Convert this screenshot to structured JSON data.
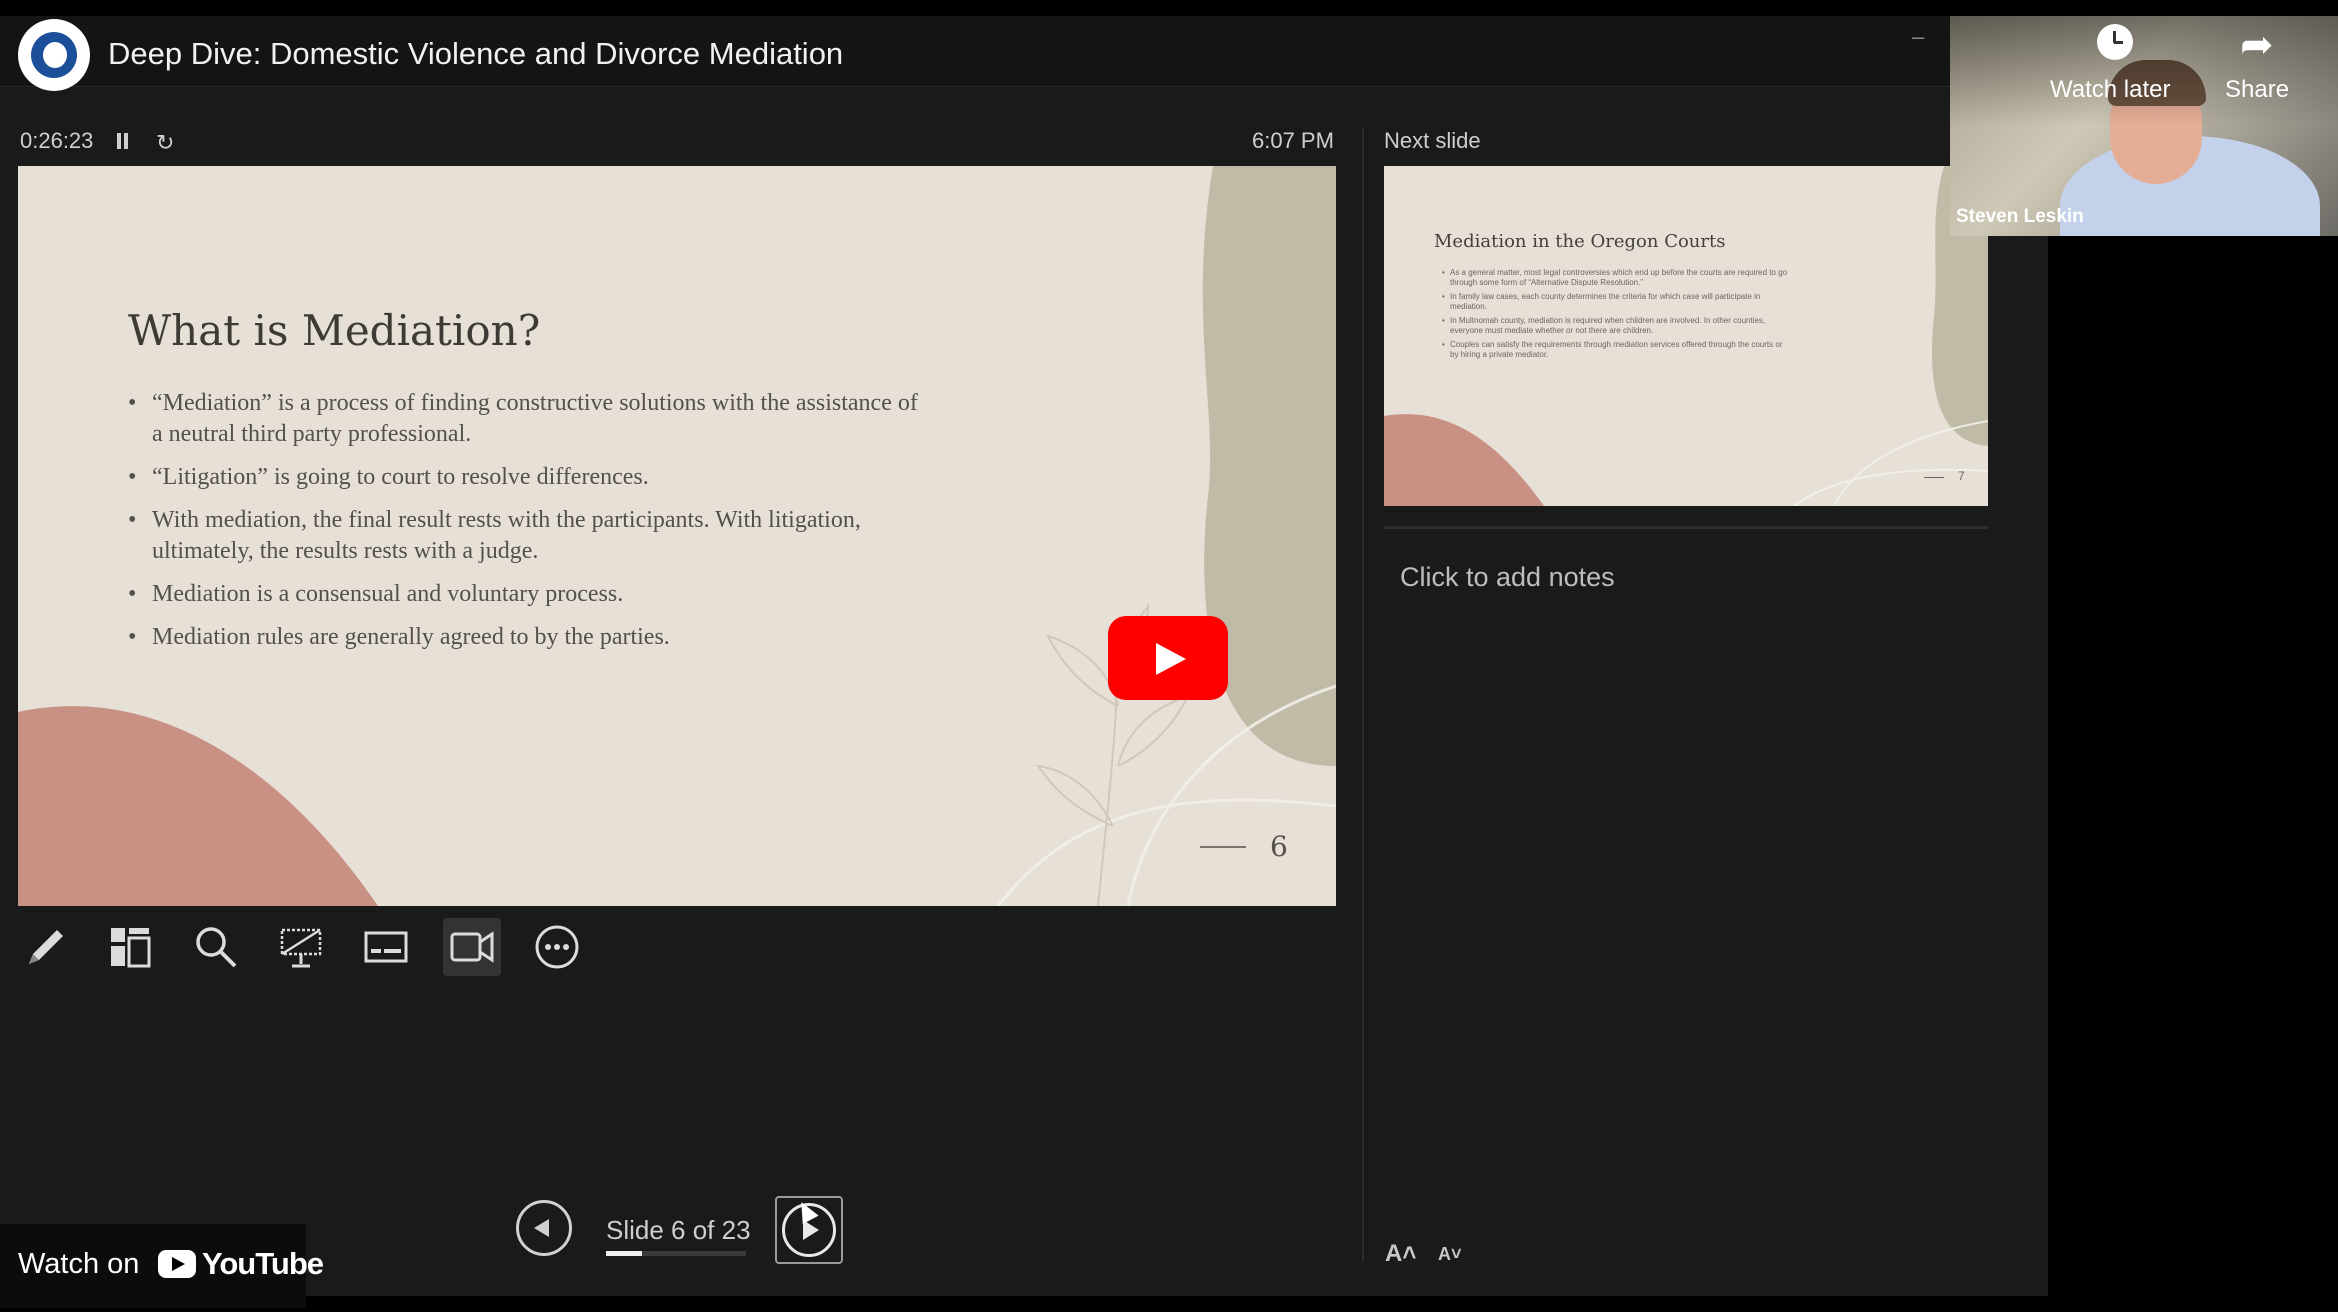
{
  "header": {
    "title": "Deep Dive: Domestic Violence and Divorce Mediation",
    "channel_logo": "circle-d-logo"
  },
  "presenter_view": {
    "elapsed_time": "0:26:23",
    "clock_time": "6:07 PM",
    "next_slide_label": "Next slide",
    "notes_placeholder": "Click to add notes",
    "current_slide": {
      "title": "What is Mediation?",
      "bullets": [
        "“Mediation” is a process of finding constructive solutions with the assistance of a neutral third party professional.",
        "“Litigation” is going to court to resolve differences.",
        "With mediation, the final result rests with the participants. With litigation, ultimately, the results rests with a judge.",
        "Mediation is a consensual and voluntary process.",
        "Mediation rules are generally agreed to by the parties."
      ],
      "number": "6"
    },
    "next_slide": {
      "title": "Mediation in the Oregon Courts",
      "bullets": [
        "As a general matter, most legal controversies which end up before the courts are required to go through some form of “Alternative Dispute Resolution.”",
        "In family law cases, each county determines the criteria for which case will participate in mediation.",
        "In Multnomah county, mediation is required when children are involved. In other counties, everyone must mediate whether or not there are children.",
        "Couples can satisfy the requirements through mediation services offered through the courts or by hiring a private mediator."
      ],
      "number": "7"
    },
    "slide_counter": "Slide 6 of 23",
    "progress_fraction": 0.26,
    "tools": [
      "pen-icon",
      "slides-grid-icon",
      "zoom-icon",
      "laser-pointer-icon",
      "subtitles-icon",
      "camera-icon",
      "more-options-icon"
    ],
    "font_increase": "A˄",
    "font_decrease": "A˅"
  },
  "overlay": {
    "watch_on": "Watch on",
    "youtube": "YouTube",
    "watch_later": "Watch later",
    "share": "Share",
    "participant_name": "Steven Leskin"
  },
  "colors": {
    "slide_bg": "#e6e0d7",
    "accent_rose": "#c89183",
    "accent_sage": "#bfbba7",
    "youtube_red": "#ff0000"
  }
}
